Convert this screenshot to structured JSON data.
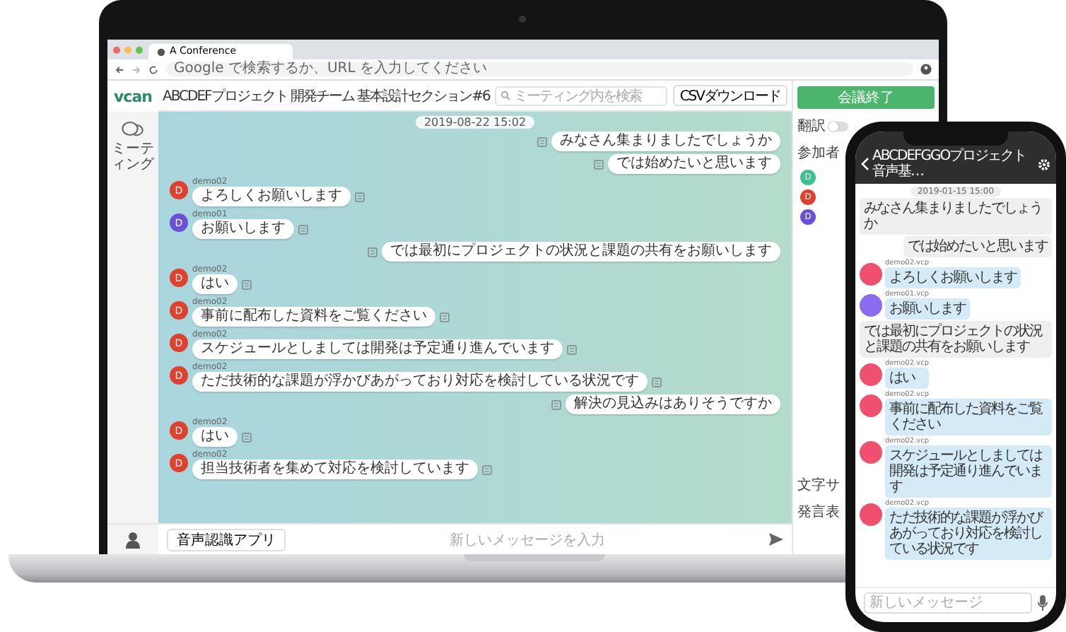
{
  "browser": {
    "tab_title": "A Conference",
    "address_placeholder": "Google で検索するか、URL を入力してください"
  },
  "app": {
    "logo": "vcan",
    "breadcrumb": "ABCDEFプロジェクト 開発チーム 基本設計セクション#6",
    "search_placeholder": "ミーティング内を検索",
    "csv_button": "CSVダウンロード",
    "sidebar_label": "ミーティング"
  },
  "chat": {
    "timestamp": "2019-08-22 15:02",
    "messages": [
      {
        "kind": "sent",
        "text": "みなさん集まりましたでしょうか"
      },
      {
        "kind": "sent",
        "text": "では始めたいと思います"
      },
      {
        "kind": "received",
        "name": "demo02",
        "initial": "D",
        "color": "#e0412f",
        "text": "よろしくお願いします"
      },
      {
        "kind": "received",
        "name": "demo01",
        "initial": "D",
        "color": "#6a4fd8",
        "text": "お願いします"
      },
      {
        "kind": "sent",
        "text": "では最初にプロジェクトの状況と課題の共有をお願いします"
      },
      {
        "kind": "received",
        "name": "demo02",
        "initial": "D",
        "color": "#e0412f",
        "text": "はい"
      },
      {
        "kind": "received",
        "name": "demo02",
        "initial": "D",
        "color": "#e0412f",
        "text": "事前に配布した資料をご覧ください"
      },
      {
        "kind": "received",
        "name": "demo02",
        "initial": "D",
        "color": "#e0412f",
        "text": "スケジュールとしましては開発は予定通り進んでいます"
      },
      {
        "kind": "received",
        "name": "demo02",
        "initial": "D",
        "color": "#e0412f",
        "text": "ただ技術的な課題が浮かびあがっており対応を検討している状況です"
      },
      {
        "kind": "sent",
        "text": "解決の見込みはありそうですか"
      },
      {
        "kind": "received",
        "name": "demo02",
        "initial": "D",
        "color": "#e0412f",
        "text": "はい"
      },
      {
        "kind": "received",
        "name": "demo02",
        "initial": "D",
        "color": "#e0412f",
        "text": "担当技術者を集めて対応を検討しています"
      }
    ]
  },
  "composer": {
    "voice_button": "音声認識アプリ",
    "placeholder": "新しいメッセージを入力"
  },
  "panel": {
    "end_button": "会議終了",
    "translate_label": "翻訳",
    "translate_on": false,
    "participants_label": "参加者",
    "participants": [
      {
        "initial": "D",
        "color": "#3dbf8f"
      },
      {
        "initial": "D",
        "color": "#e0412f"
      },
      {
        "initial": "D",
        "color": "#6a4fd8"
      }
    ],
    "option_labels": [
      "文字サ",
      "発言表"
    ]
  },
  "phone": {
    "title": "ABCDEFGGOプロジェクト",
    "subtitle": "音声基…",
    "timestamp": "2019-01-15 15:00",
    "placeholder": "新しいメッセージ",
    "messages": [
      {
        "kind": "sent",
        "text": "みなさん集まりましたでしょうか"
      },
      {
        "kind": "sent",
        "text": "では始めたいと思います"
      },
      {
        "kind": "received",
        "name": "demo02.vcp",
        "color": "#f0506e",
        "text": "よろしくお願いします"
      },
      {
        "kind": "received",
        "name": "demo01.vcp",
        "color": "#8a6cf0",
        "text": "お願いします"
      },
      {
        "kind": "sent",
        "text": "では最初にプロジェクトの状況と課題の共有をお願いします"
      },
      {
        "kind": "received",
        "name": "demo02.vcp",
        "color": "#f0506e",
        "text": "はい"
      },
      {
        "kind": "received",
        "name": "demo02.vcp",
        "color": "#f0506e",
        "text": "事前に配布した資料をご覧ください"
      },
      {
        "kind": "received",
        "name": "demo02.vcp",
        "color": "#f0506e",
        "text": "スケジュールとしましては開発は予定通り進んでいます"
      },
      {
        "kind": "received",
        "name": "demo02.vcp",
        "color": "#f0506e",
        "text": "ただ技術的な課題が浮かびあがっており対応を検討している状況です"
      }
    ]
  }
}
